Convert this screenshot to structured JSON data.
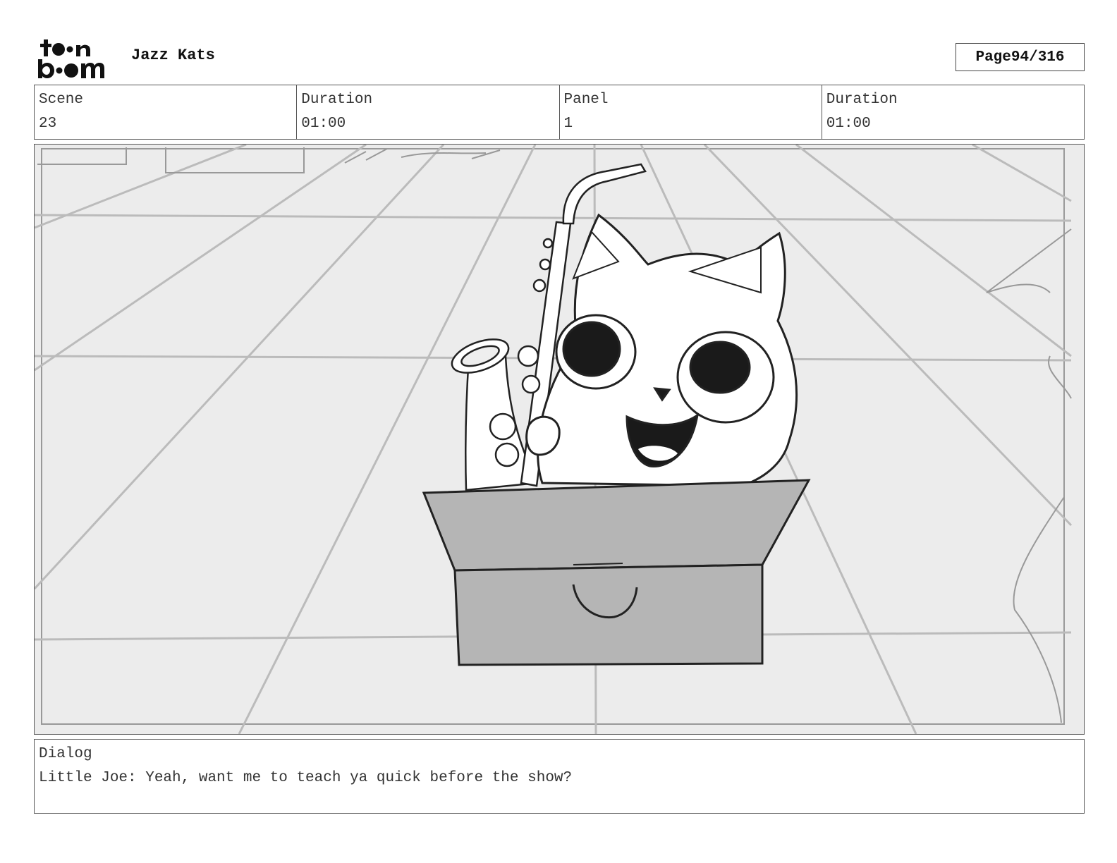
{
  "header": {
    "logo_text": "toon boom",
    "project_title": "Jazz Kats",
    "page_label": "Page",
    "page_number": "94/316"
  },
  "info": {
    "scene_label": "Scene",
    "scene_value": "23",
    "scene_duration_label": "Duration",
    "scene_duration_value": "01:00",
    "panel_label": "Panel",
    "panel_value": "1",
    "panel_duration_label": "Duration",
    "panel_duration_value": "01:00"
  },
  "dialog": {
    "label": "Dialog",
    "text": "Little Joe: Yeah, want me to teach ya quick before the show?"
  }
}
